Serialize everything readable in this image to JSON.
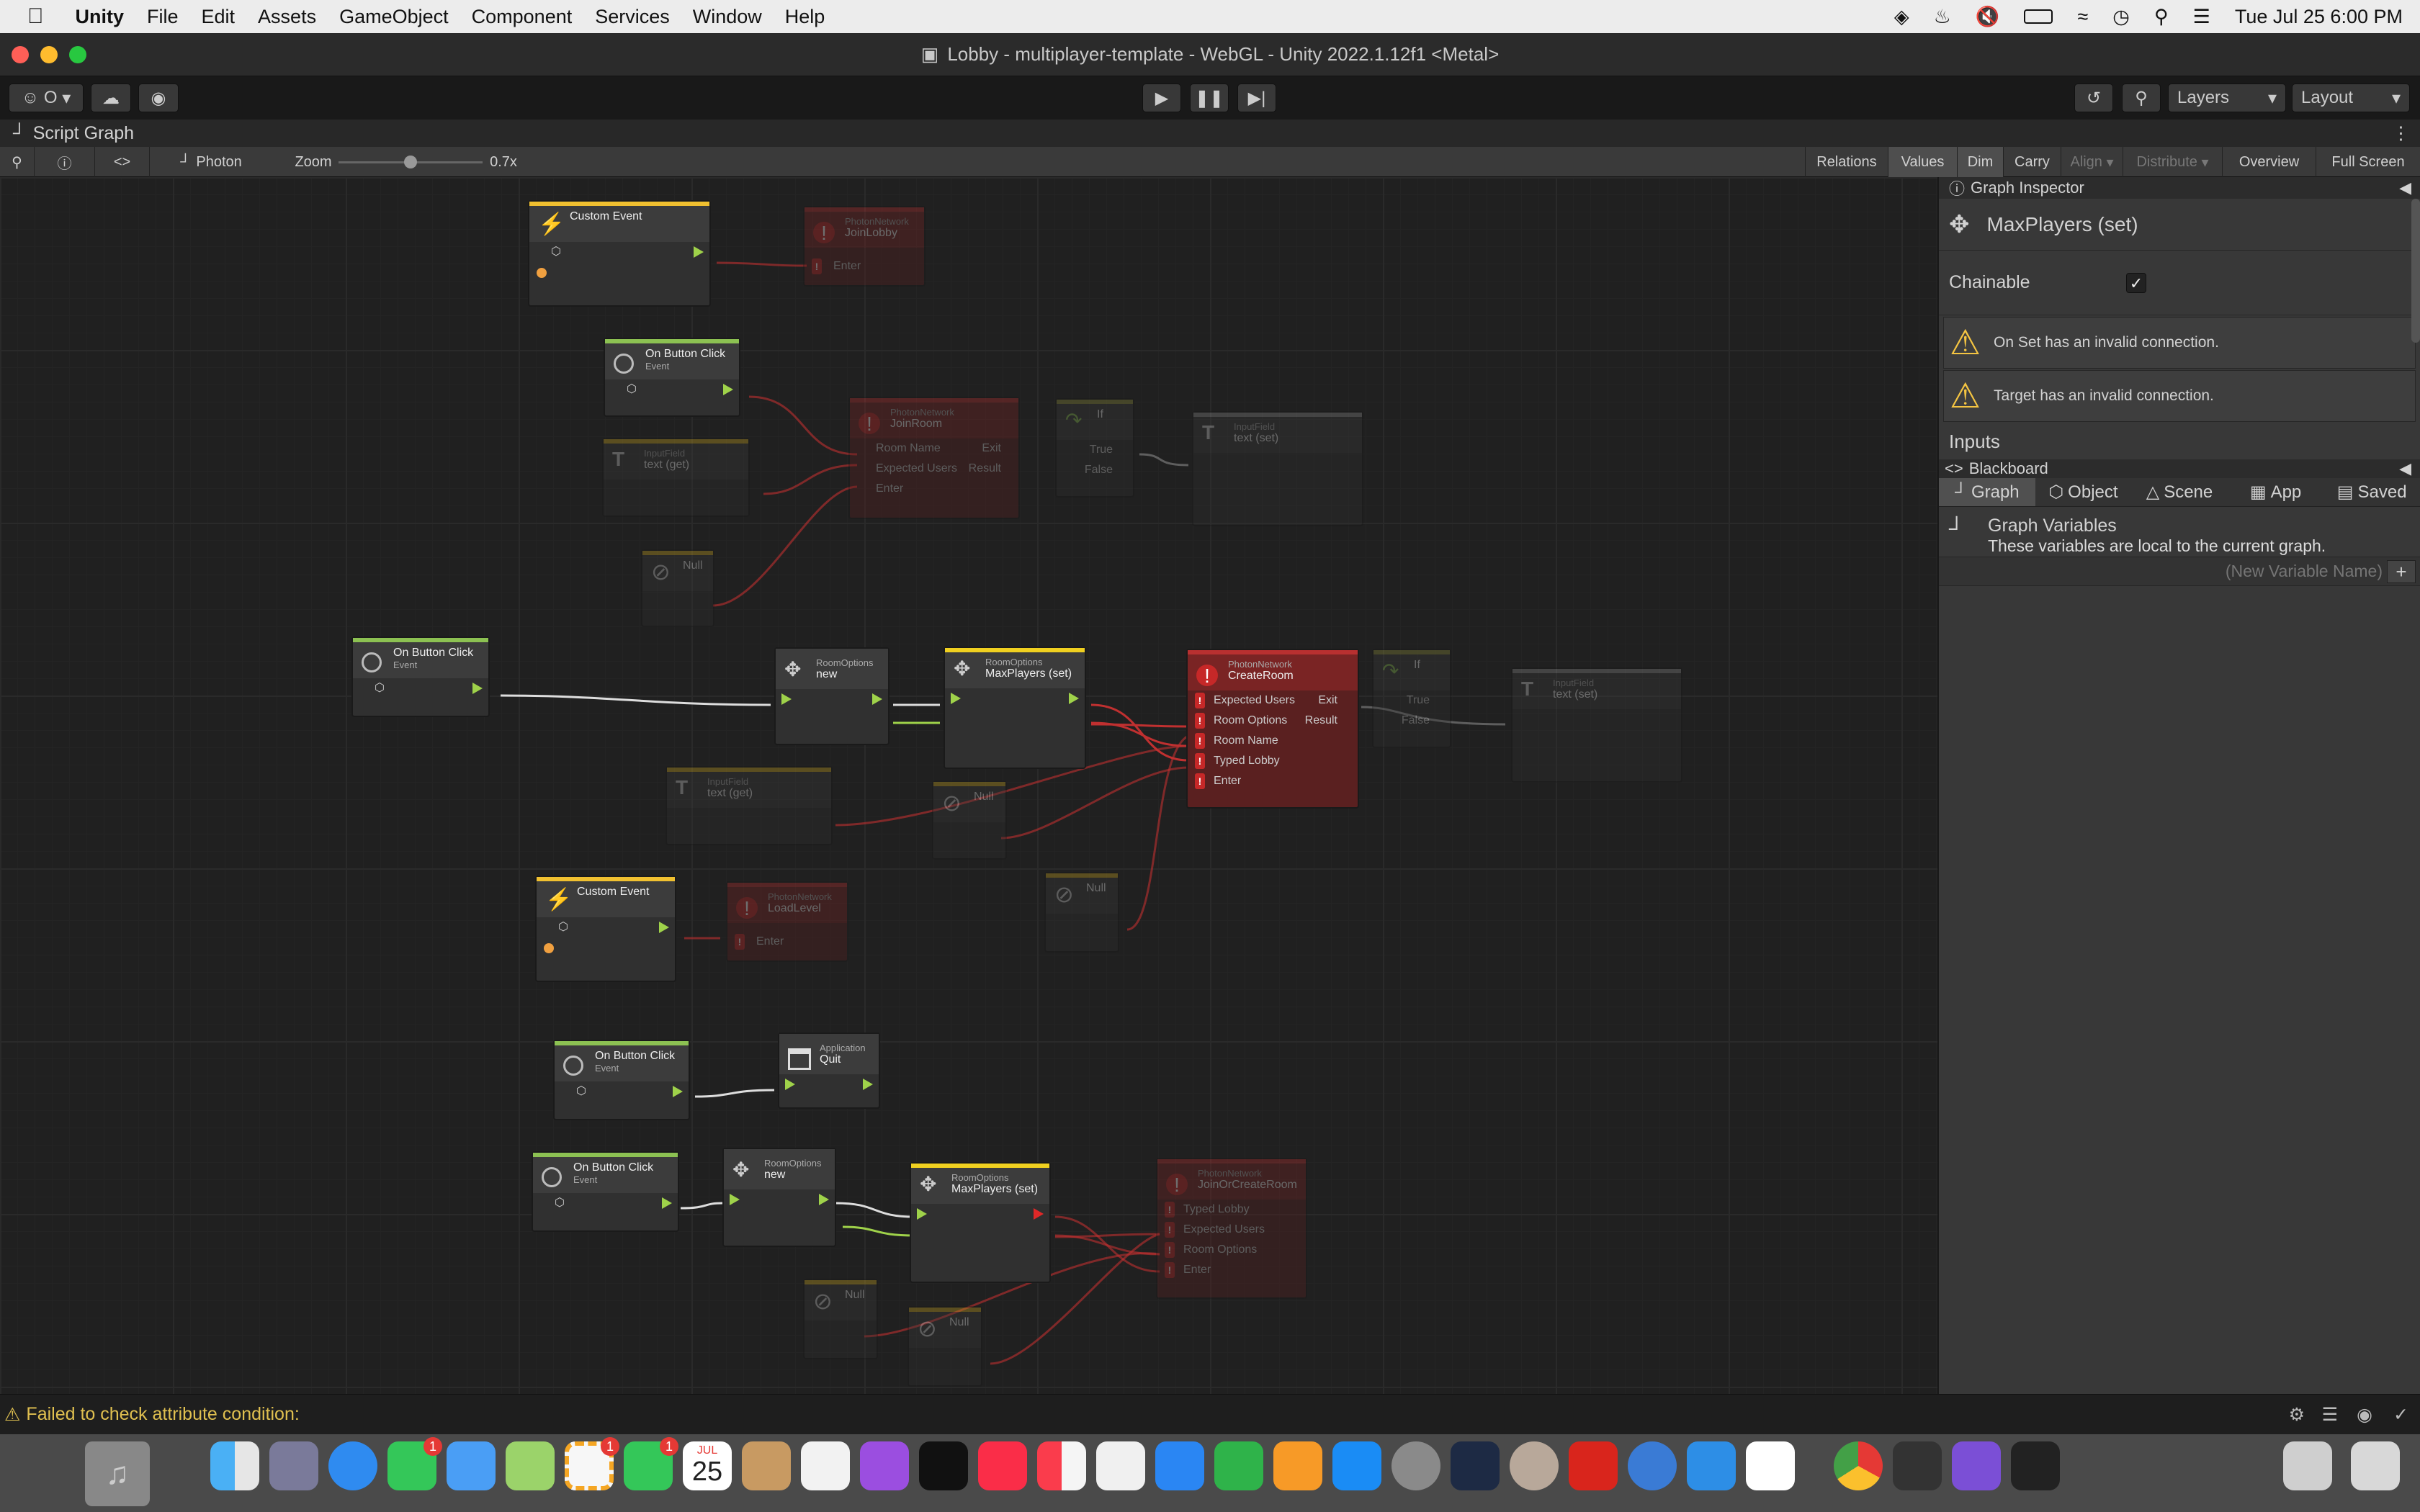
{
  "menubar": {
    "app": "Unity",
    "items": [
      "File",
      "Edit",
      "Assets",
      "GameObject",
      "Component",
      "Services",
      "Window",
      "Help"
    ],
    "clock": "Tue Jul 25  6:00 PM"
  },
  "window": {
    "title": "Lobby - multiplayer-template - WebGL - Unity 2022.1.12f1 <Metal>"
  },
  "toolbar": {
    "account": "O",
    "layers": "Layers",
    "layout": "Layout"
  },
  "panel": {
    "tab": "Script Graph",
    "photon": "Photon",
    "zoom_label": "Zoom",
    "zoom_value": "0.7x",
    "zoom_fraction": 0.5
  },
  "graph_toolbar": [
    "Relations",
    "Values",
    "Dim",
    "Carry",
    "Align",
    "Distribute",
    "Overview",
    "Full Screen"
  ],
  "nodes": {
    "custom_event_1": "Custom Event",
    "join_lobby": {
      "sub": "PhotonNetwork",
      "title": "JoinLobby",
      "enter": "Enter"
    },
    "btn1": {
      "title": "On Button Click",
      "sub": "Event"
    },
    "join_room": {
      "sub": "PhotonNetwork",
      "title": "JoinRoom",
      "rows": [
        "Room Name",
        "Expected Users",
        "Enter"
      ],
      "exit": "Exit",
      "result": "Result"
    },
    "if1": {
      "title": "If",
      "true": "True",
      "false": "False"
    },
    "set_text1": {
      "sub": "InputField",
      "title": "text (set)"
    },
    "get_text1": {
      "sub": "InputField",
      "title": "text (get)"
    },
    "null_a": "Null",
    "btn2": {
      "title": "On Button Click",
      "sub": "Event"
    },
    "room_new1": {
      "sub": "RoomOptions",
      "title": "new"
    },
    "maxp1": {
      "sub": "RoomOptions",
      "title": "MaxPlayers (set)"
    },
    "create_room": {
      "sub": "PhotonNetwork",
      "title": "CreateRoom",
      "rows": [
        "Expected Users",
        "Room Options",
        "Room Name",
        "Typed Lobby",
        "Enter"
      ],
      "exit": "Exit",
      "result": "Result"
    },
    "if2": {
      "title": "If",
      "true": "True",
      "false": "False"
    },
    "set_text2": {
      "sub": "InputField",
      "title": "text (set)"
    },
    "get_text2": {
      "sub": "InputField",
      "title": "text (get)"
    },
    "null_b": "Null",
    "null_c": "Null",
    "custom_event_2": "Custom Event",
    "load_level": {
      "sub": "PhotonNetwork",
      "title": "LoadLevel",
      "enter": "Enter"
    },
    "btn3": {
      "title": "On Button Click",
      "sub": "Event"
    },
    "app_quit": {
      "sub": "Application",
      "title": "Quit"
    },
    "btn4": {
      "title": "On Button Click",
      "sub": "Event"
    },
    "room_new2": {
      "sub": "RoomOptions",
      "title": "new"
    },
    "maxp2": {
      "sub": "RoomOptions",
      "title": "MaxPlayers (set)"
    },
    "join_or_create": {
      "sub": "PhotonNetwork",
      "title": "JoinOrCreateRoom",
      "rows": [
        "Typed Lobby",
        "Expected Users",
        "Room Options",
        "Enter"
      ]
    },
    "null_d": "Null",
    "null_e": "Null"
  },
  "inspector": {
    "header": "Graph Inspector",
    "node_title": "MaxPlayers (set)",
    "chainable_label": "Chainable",
    "chainable": true,
    "warnings": [
      "On Set has an invalid connection.",
      "Target has an invalid connection."
    ],
    "inputs": "Inputs",
    "blackboard": "Blackboard",
    "tabs": [
      "Graph",
      "Object",
      "Scene",
      "App",
      "Saved"
    ],
    "vars_title": "Graph Variables",
    "vars_desc": "These variables are local to the current graph.",
    "new_var_placeholder": "(New Variable Name)"
  },
  "status": {
    "message": "Failed to check attribute condition:"
  },
  "dock": {
    "calendar_month": "JUL",
    "calendar_day": "25",
    "badges": {
      "messages": "1",
      "photos": "1",
      "facetime": "1"
    }
  },
  "colors": {
    "flow": "#9fd24a",
    "error": "#c62828",
    "event": "#f0c030",
    "button_event": "#8cc152",
    "warning": "#e0c050"
  }
}
